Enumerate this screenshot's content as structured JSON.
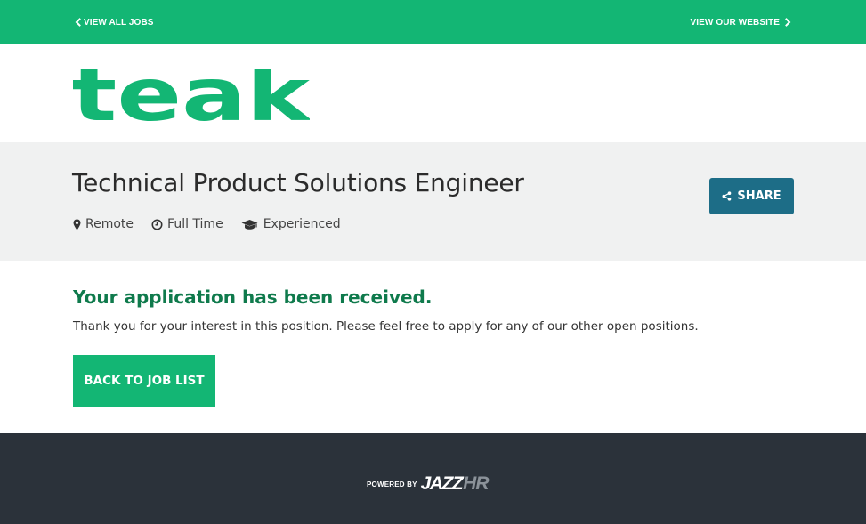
{
  "nav": {
    "back_label": "VIEW ALL JOBS",
    "website_label": "VIEW OUR WEBSITE"
  },
  "brand": {
    "logo_text": "teak",
    "logo_color": "#13b674"
  },
  "job": {
    "title": "Technical Product Solutions Engineer",
    "location": "Remote",
    "type": "Full Time",
    "experience": "Experienced",
    "share_label": "SHARE"
  },
  "confirmation": {
    "heading": "Your application has been received.",
    "message": "Thank you for your interest in this position. Please feel free to apply for any of our other open positions.",
    "back_button_label": "BACK TO JOB LIST"
  },
  "footer": {
    "powered_by_label": "POWERED BY",
    "vendor_jazz": "JAZZ",
    "vendor_hr": "HR"
  },
  "colors": {
    "accent": "#13b674",
    "share_button": "#1d6d87",
    "heading_green": "#0f7a4c",
    "footer_bg": "#2b323a"
  },
  "icons": {
    "back": "chevron-left-icon",
    "website": "chevron-right-icon",
    "location": "map-marker-icon",
    "type": "clock-icon",
    "experience": "graduation-cap-icon",
    "share": "share-icon"
  }
}
